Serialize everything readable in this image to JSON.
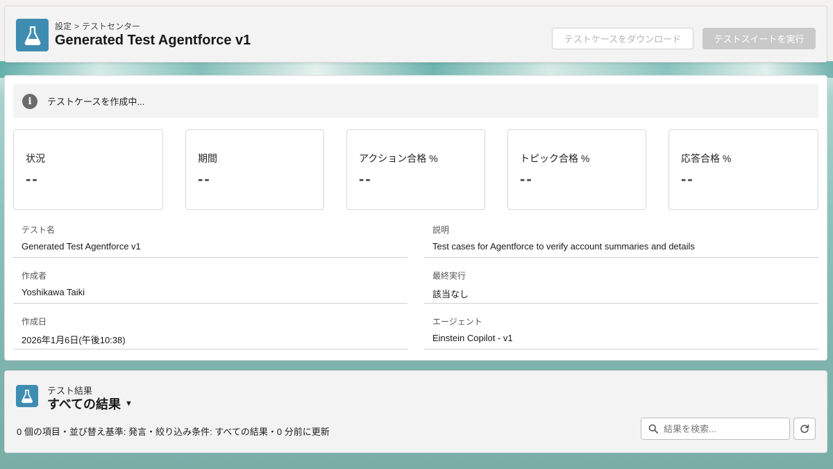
{
  "header": {
    "icon": "flask-icon",
    "breadcrumb": {
      "parent": "設定",
      "separator": ">",
      "current": "テストセンター"
    },
    "title": "Generated Test Agentforce v1",
    "download_button": "テストケースをダウンロード",
    "run_button": "テストスイートを実行"
  },
  "info_bar": {
    "icon": "info-icon",
    "text": "テストケースを作成中..."
  },
  "metrics": [
    {
      "label": "状況",
      "value": "--"
    },
    {
      "label": "期間",
      "value": "--"
    },
    {
      "label": "アクション合格 %",
      "value": "--"
    },
    {
      "label": "トピック合格 %",
      "value": "--"
    },
    {
      "label": "応答合格 %",
      "value": "--"
    }
  ],
  "details": {
    "test_name": {
      "label": "テスト名",
      "value": "Generated Test Agentforce v1"
    },
    "description": {
      "label": "説明",
      "value": "Test cases for Agentforce to verify account summaries and details"
    },
    "created_by": {
      "label": "作成者",
      "value": "Yoshikawa Taiki"
    },
    "last_run": {
      "label": "最終実行",
      "value": "該当なし"
    },
    "created_date": {
      "label": "作成日",
      "value": "2026年1月6日(午後10:38)"
    },
    "agent": {
      "label": "エージェント",
      "value": "Einstein Copilot - v1"
    }
  },
  "results": {
    "icon": "flask-icon",
    "subtitle": "テスト結果",
    "title": "すべての結果",
    "meta": "0 個の項目・並び替え基準: 発言・絞り込み条件: すべての結果・0 分前に更新",
    "search_placeholder": "結果を検索...",
    "refresh_icon": "refresh-icon"
  },
  "colors": {
    "accent": "#3e8db1",
    "disabled_button": "#c9c9c9",
    "background": "#8ec3bd"
  }
}
